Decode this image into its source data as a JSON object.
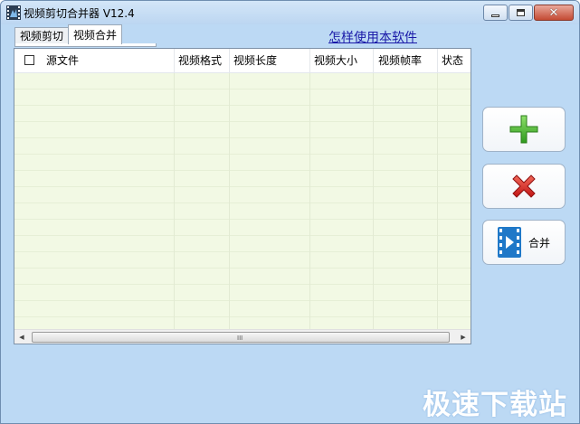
{
  "window": {
    "title": "视频剪切合并器 V12.4",
    "close_glyph": "✕"
  },
  "tabs": [
    {
      "label": "视频剪切"
    },
    {
      "label": "视频合并"
    }
  ],
  "help_link": "怎样使用本软件",
  "table": {
    "columns": [
      "源文件",
      "视频格式",
      "视频长度",
      "视频大小",
      "视频帧率",
      "状态"
    ],
    "rows": []
  },
  "scrollbar": {
    "left_arrow": "◀",
    "right_arrow": "▶",
    "grip": "III"
  },
  "buttons": {
    "add_icon": "plus-icon",
    "remove_icon": "red-x-icon",
    "merge_label": "合并",
    "merge_icon": "film-play-icon"
  },
  "watermark": "极速下载站",
  "colors": {
    "window_bg": "#bcd9f4",
    "list_bg": "#f2f9e4",
    "plus_green": "#3fae2a",
    "remove_red": "#d42020",
    "merge_blue": "#1f78c8",
    "link": "#1a1aa8"
  }
}
